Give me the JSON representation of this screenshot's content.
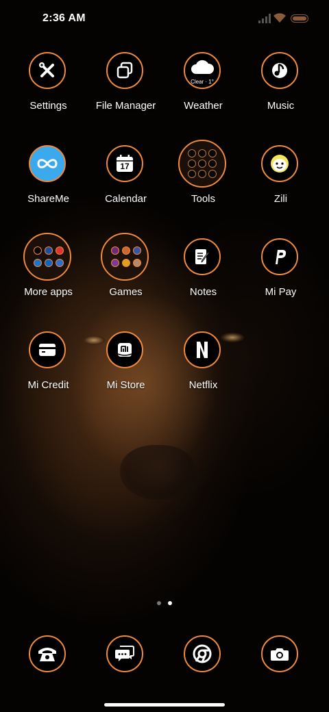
{
  "status_bar": {
    "time": "2:36 AM"
  },
  "apps": [
    {
      "name": "settings",
      "label": "Settings",
      "icon": "wrench-screwdriver-icon"
    },
    {
      "name": "file-manager",
      "label": "File Manager",
      "icon": "stacked-squares-icon"
    },
    {
      "name": "weather",
      "label": "Weather",
      "icon": "cloud-icon",
      "info": "Clear · 1°"
    },
    {
      "name": "music",
      "label": "Music",
      "icon": "music-note-icon"
    },
    {
      "name": "shareme",
      "label": "ShareMe",
      "icon": "infinity-icon"
    },
    {
      "name": "calendar",
      "label": "Calendar",
      "icon": "calendar-icon",
      "day": "17"
    },
    {
      "name": "tools",
      "label": "Tools",
      "icon": "folder-icon"
    },
    {
      "name": "zili",
      "label": "Zili",
      "icon": "smiley-face-icon"
    },
    {
      "name": "more-apps",
      "label": "More apps",
      "icon": "folder-icon"
    },
    {
      "name": "games",
      "label": "Games",
      "icon": "folder-icon"
    },
    {
      "name": "notes",
      "label": "Notes",
      "icon": "notepad-pen-icon"
    },
    {
      "name": "mi-pay",
      "label": "Mi Pay",
      "icon": "p-letter-icon"
    },
    {
      "name": "mi-credit",
      "label": "Mi Credit",
      "icon": "credit-card-icon"
    },
    {
      "name": "mi-store",
      "label": "Mi Store",
      "icon": "mi-bag-icon"
    },
    {
      "name": "netflix",
      "label": "Netflix",
      "icon": "n-letter-icon"
    }
  ],
  "dock": [
    {
      "name": "phone",
      "icon": "phone-icon"
    },
    {
      "name": "messages",
      "icon": "chat-bubble-icon"
    },
    {
      "name": "chrome",
      "icon": "chrome-icon"
    },
    {
      "name": "camera",
      "icon": "camera-icon"
    }
  ],
  "page_indicator": {
    "current": 2,
    "total": 2
  },
  "colors": {
    "accent": "#f08a3c",
    "text": "#ffffff",
    "background": "#050302"
  }
}
